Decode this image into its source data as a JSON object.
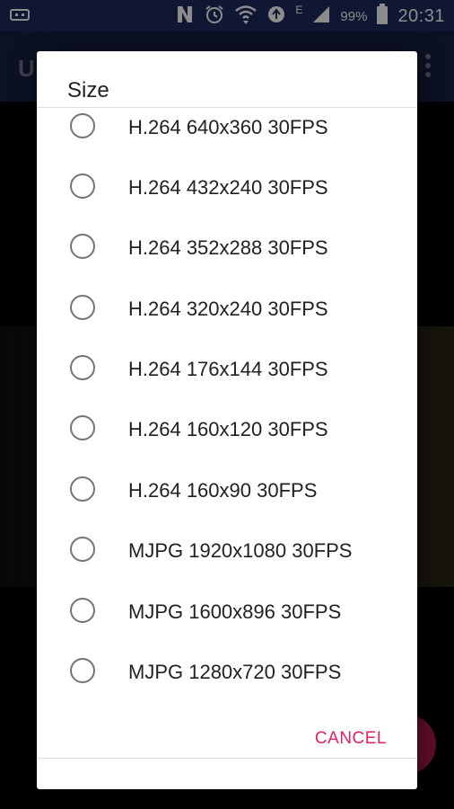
{
  "status_bar": {
    "time": "20:31",
    "battery_percent": "99%",
    "lte_label": "E",
    "icons": [
      "usb-icon",
      "nfc-icon",
      "alarm-icon",
      "wifi-icon",
      "data-sync-icon",
      "signal-icon",
      "battery-icon"
    ]
  },
  "app_bar": {
    "title_visible_fragment": "U",
    "menu_icon": "overflow-menu-icon"
  },
  "dialog": {
    "title": "Size",
    "options": [
      {
        "label": "H.264 640x360 30FPS",
        "selected": false
      },
      {
        "label": "H.264 432x240 30FPS",
        "selected": false
      },
      {
        "label": "H.264 352x288 30FPS",
        "selected": false
      },
      {
        "label": "H.264 320x240 30FPS",
        "selected": false
      },
      {
        "label": "H.264 176x144 30FPS",
        "selected": false
      },
      {
        "label": "H.264 160x120 30FPS",
        "selected": false
      },
      {
        "label": "H.264 160x90 30FPS",
        "selected": false
      },
      {
        "label": "MJPG 1920x1080 30FPS",
        "selected": false
      },
      {
        "label": "MJPG 1600x896 30FPS",
        "selected": false
      },
      {
        "label": "MJPG 1280x720 30FPS",
        "selected": false
      }
    ],
    "cancel_label": "CANCEL"
  },
  "colors": {
    "status_bar_bg": "#1d2a5c",
    "accent": "#e91e63",
    "fab": "#b0184c",
    "radio_border": "#757575"
  }
}
